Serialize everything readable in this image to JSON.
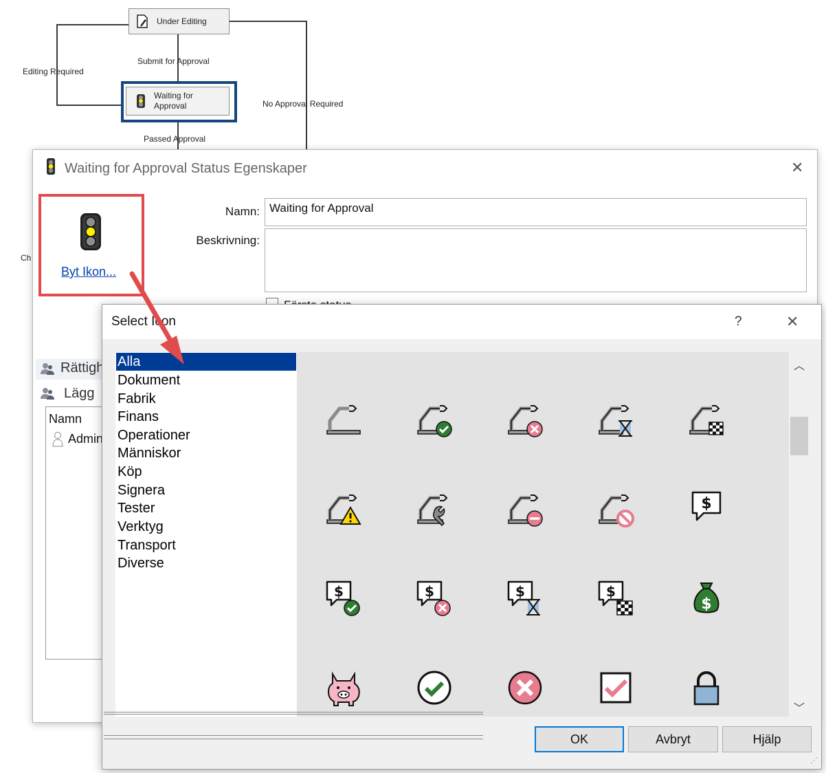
{
  "workflow": {
    "under_editing": "Under Editing",
    "waiting_line1": "Waiting for",
    "waiting_line2": "Approval",
    "submit_for_approval": "Submit for Approval",
    "editing_required": "Editing Required",
    "no_approval_required": "No Approval Required",
    "passed_approval": "Passed Approval",
    "partial_left": "Ch"
  },
  "properties_dialog": {
    "title": "Waiting for Approval Status Egenskaper",
    "change_icon_link": "Byt Ikon...",
    "name_label": "Namn:",
    "name_value": "Waiting for Approval",
    "description_label": "Beskrivning:",
    "description_value": "",
    "first_status_partial": "Första status",
    "permissions_tab_partial": "Rättigh",
    "add_partial": "Lägg",
    "list_header": "Namn",
    "list_item_partial": "Admin"
  },
  "select_icon_dialog": {
    "title": "Select Icon",
    "help": "?",
    "categories": [
      "Alla",
      "Dokument",
      "Fabrik",
      "Finans",
      "Operationer",
      "Människor",
      "Köp",
      "Signera",
      "Tester",
      "Verktyg",
      "Transport",
      "Diverse"
    ],
    "selected_category": "Alla",
    "buttons": {
      "ok": "OK",
      "cancel": "Avbryt",
      "help": "Hjälp"
    }
  },
  "colors": {
    "selection_blue": "#003c96",
    "highlight_red": "#e24b4b",
    "frame_blue": "#14467e",
    "check_green": "#2e7d32",
    "error_pink": "#e87c8f"
  }
}
